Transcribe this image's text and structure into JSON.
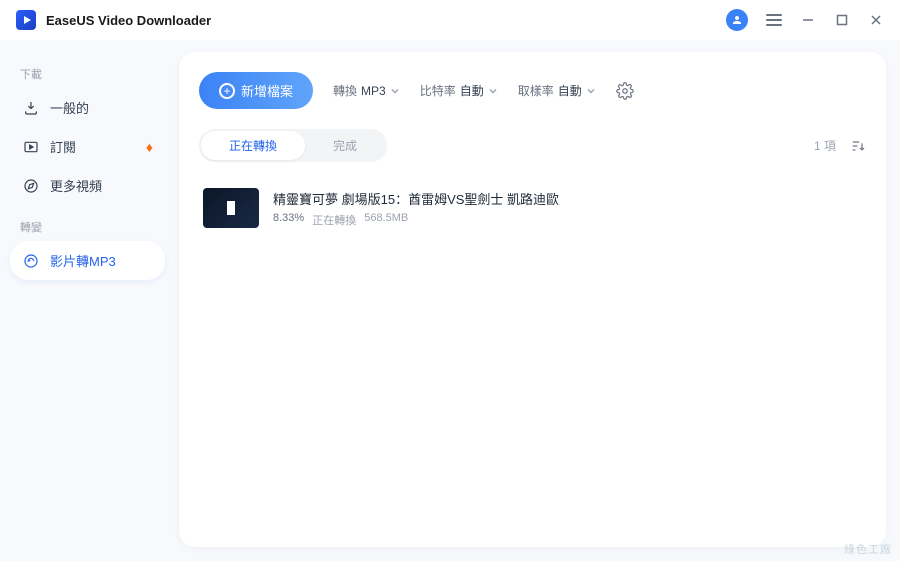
{
  "app": {
    "title": "EaseUS Video Downloader"
  },
  "sidebar": {
    "section_download": "下載",
    "section_convert": "轉變",
    "items": {
      "general": "一般的",
      "subscribe": "訂閱",
      "more_videos": "更多視頻",
      "video_to_mp3": "影片轉MP3"
    }
  },
  "toolbar": {
    "add_label": "新增檔案",
    "convert": {
      "label": "轉換",
      "value": "MP3"
    },
    "bitrate": {
      "label": "比特率",
      "value": "自動"
    },
    "samplerate": {
      "label": "取樣率",
      "value": "自動"
    }
  },
  "tabs": {
    "converting": "正在轉換",
    "completed": "完成"
  },
  "list": {
    "count_label": "1 項",
    "items": [
      {
        "title": "精靈寶可夢 劇場版15：酋雷姆VS聖劍士 凱路迪歐",
        "percent": "8.33%",
        "status": "正在轉換",
        "size": "568.5MB"
      }
    ]
  },
  "watermark": "綠色工廠"
}
